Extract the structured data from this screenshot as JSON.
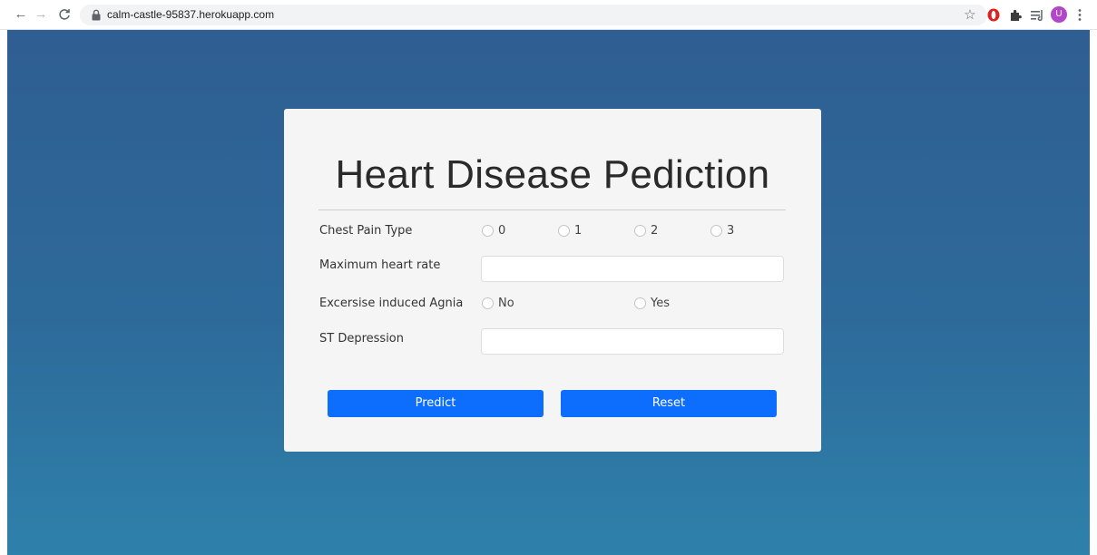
{
  "browser": {
    "url": "calm-castle-95837.herokuapp.com",
    "avatar_letter": "U"
  },
  "form": {
    "title": "Heart Disease Pediction",
    "chest_pain": {
      "label": "Chest Pain Type",
      "options": [
        "0",
        "1",
        "2",
        "3"
      ]
    },
    "max_heart_rate": {
      "label": "Maximum heart rate",
      "value": ""
    },
    "exercise_angina": {
      "label": "Excersise induced Agnia",
      "options": [
        "No",
        "Yes"
      ]
    },
    "st_depression": {
      "label": "ST Depression",
      "value": ""
    },
    "predict_label": "Predict",
    "reset_label": "Reset"
  },
  "colors": {
    "primary_button": "#0d6efd",
    "background_top": "#2f5e92",
    "background_bottom": "#2e81ab",
    "avatar": "#b345c9"
  }
}
